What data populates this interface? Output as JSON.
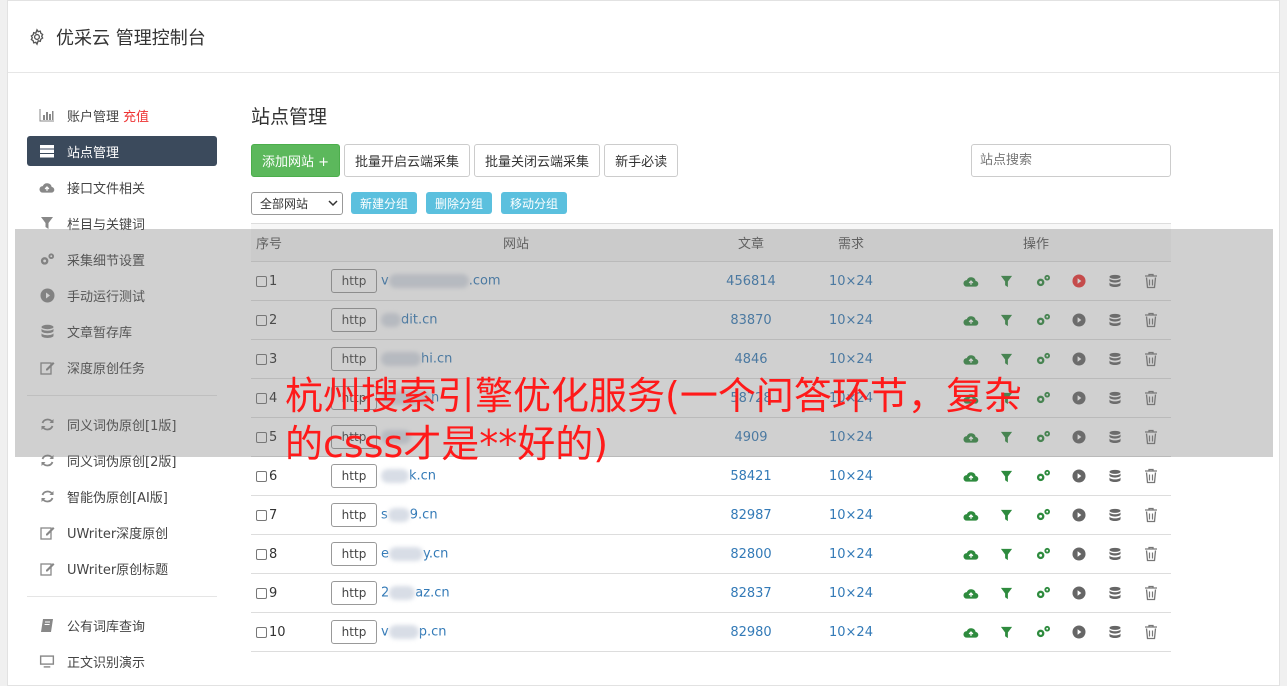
{
  "app": {
    "title": "优采云 管理控制台"
  },
  "sidebar": {
    "items": [
      {
        "label": "账户管理",
        "extra": "充值",
        "icon": "bar-chart-icon"
      },
      {
        "label": "站点管理",
        "icon": "server-icon",
        "active": true
      },
      {
        "label": "接口文件相关",
        "icon": "cloud-upload-icon"
      },
      {
        "label": "栏目与关键词",
        "icon": "filter-icon"
      },
      {
        "label": "采集细节设置",
        "icon": "cogs-icon"
      },
      {
        "label": "手动运行测试",
        "icon": "play-circle-icon"
      },
      {
        "label": "文章暂存库",
        "icon": "database-icon"
      },
      {
        "label": "深度原创任务",
        "icon": "edit-icon"
      },
      {
        "label": "同义词伪原创[1版]",
        "icon": "refresh-icon"
      },
      {
        "label": "同义词伪原创[2版]",
        "icon": "refresh-icon"
      },
      {
        "label": "智能伪原创[AI版]",
        "icon": "refresh-icon"
      },
      {
        "label": "UWriter深度原创",
        "icon": "edit-icon"
      },
      {
        "label": "UWriter原创标题",
        "icon": "edit-icon"
      },
      {
        "label": "公有词库查询",
        "icon": "book-icon"
      },
      {
        "label": "正文识别演示",
        "icon": "monitor-icon"
      }
    ]
  },
  "main": {
    "title": "站点管理",
    "buttons": {
      "add_site": "添加网站 +",
      "batch_open": "批量开启云端采集",
      "batch_close": "批量关闭云端采集",
      "newbie": "新手必读"
    },
    "search_placeholder": "站点搜索",
    "group_select": "全部网站",
    "group_buttons": {
      "new": "新建分组",
      "delete": "删除分组",
      "move": "移动分组"
    },
    "table": {
      "headers": {
        "no": "序号",
        "site": "网站",
        "articles": "文章",
        "demand": "需求",
        "ops": "操作"
      },
      "http_label": "http",
      "rows": [
        {
          "no": "1",
          "domain_pre": "v",
          "domain_post": ".com",
          "articles": "456814",
          "demand": "10×24",
          "running": true
        },
        {
          "no": "2",
          "domain_pre": "",
          "domain_post": "dit.cn",
          "articles": "83870",
          "demand": "10×24",
          "running": false
        },
        {
          "no": "3",
          "domain_pre": "",
          "domain_post": "hi.cn",
          "articles": "4846",
          "demand": "10×24",
          "running": false
        },
        {
          "no": "4",
          "domain_pre": "",
          "domain_post": "n",
          "articles": "58728",
          "demand": "10×24",
          "running": false
        },
        {
          "no": "5",
          "domain_pre": "",
          "domain_post": "",
          "articles": "4909",
          "demand": "10×24",
          "running": false
        },
        {
          "no": "6",
          "domain_pre": "",
          "domain_post": "k.cn",
          "articles": "58421",
          "demand": "10×24",
          "running": false
        },
        {
          "no": "7",
          "domain_pre": "s",
          "domain_post": "9.cn",
          "articles": "82987",
          "demand": "10×24",
          "running": false
        },
        {
          "no": "8",
          "domain_pre": "e",
          "domain_post": "y.cn",
          "articles": "82800",
          "demand": "10×24",
          "running": false
        },
        {
          "no": "9",
          "domain_pre": "2",
          "domain_post": "az.cn",
          "articles": "82837",
          "demand": "10×24",
          "running": false
        },
        {
          "no": "10",
          "domain_pre": "v",
          "domain_post": "p.cn",
          "articles": "82980",
          "demand": "10×24",
          "running": false
        }
      ]
    }
  },
  "overlay_text": "杭州搜索引擎优化服务(一个问答环节，复杂的csss才是**好的)",
  "colors": {
    "accent_green": "#5cb85c",
    "info_blue": "#5bc0de",
    "nav_active": "#3b4a5c",
    "link": "#337ab7",
    "danger": "#e33"
  }
}
